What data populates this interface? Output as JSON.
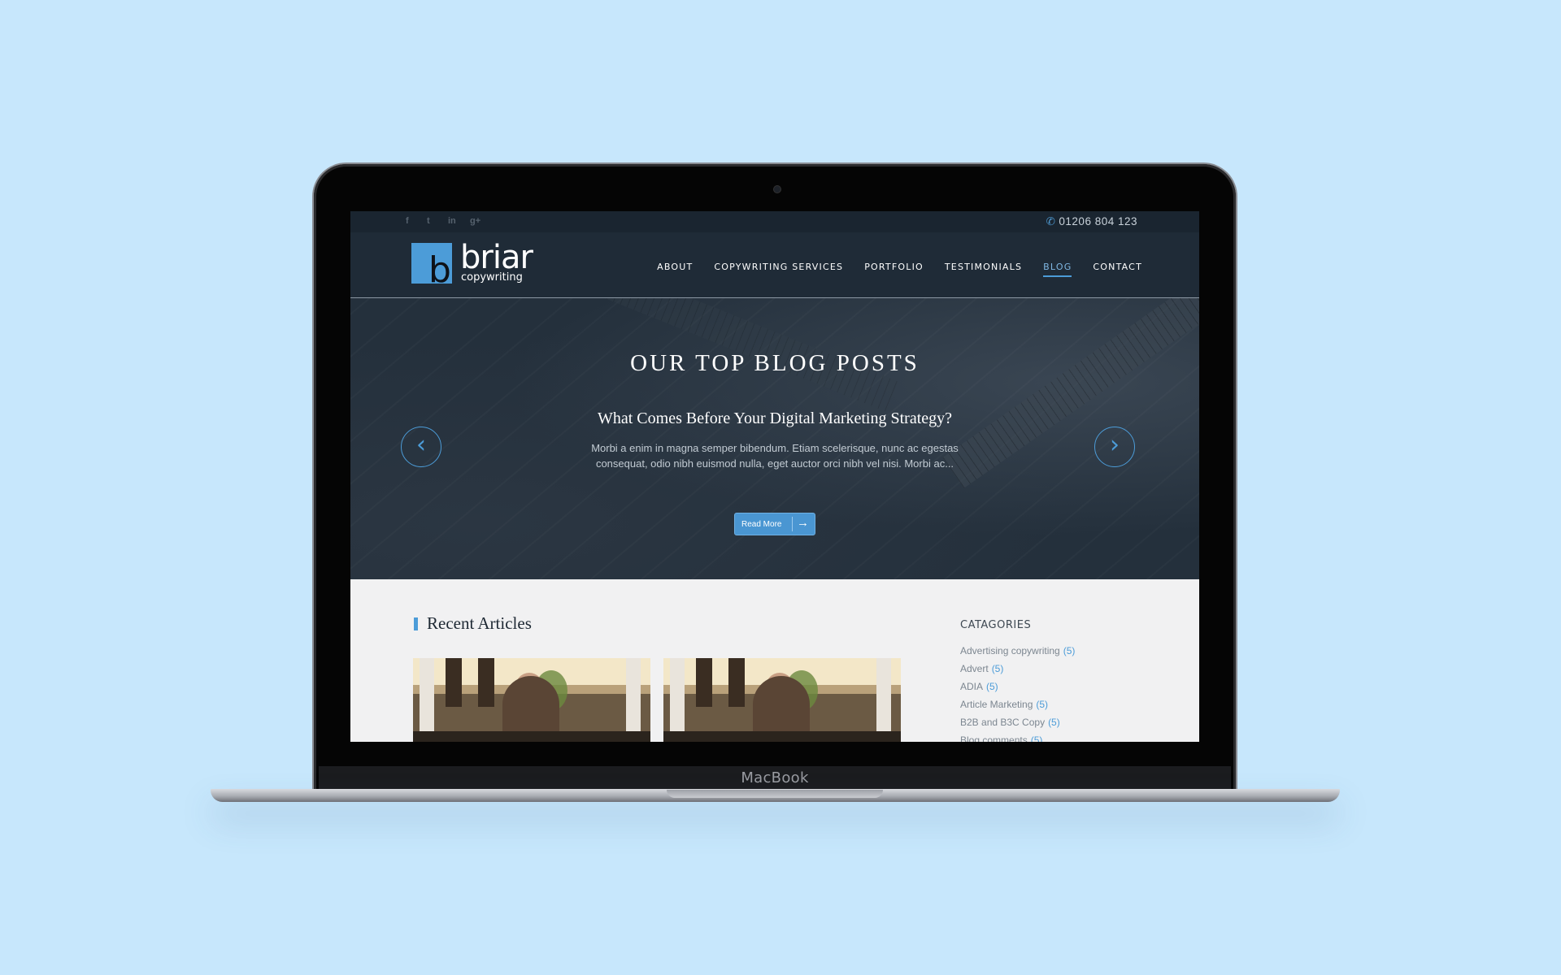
{
  "device": {
    "label": "MacBook"
  },
  "topbar": {
    "social": [
      {
        "name": "facebook-icon",
        "glyph": "f"
      },
      {
        "name": "twitter-icon",
        "glyph": "t"
      },
      {
        "name": "linkedin-icon",
        "glyph": "in"
      },
      {
        "name": "google-plus-icon",
        "glyph": "g+"
      }
    ],
    "phone": "01206 804 123"
  },
  "logo": {
    "letter": "b",
    "name": "briar",
    "tagline": "copywriting"
  },
  "nav": {
    "items": [
      {
        "label": "ABOUT"
      },
      {
        "label": "COPYWRITING SERVICES"
      },
      {
        "label": "PORTFOLIO"
      },
      {
        "label": "TESTIMONIALS"
      },
      {
        "label": "BLOG",
        "active": true
      },
      {
        "label": "CONTACT"
      }
    ]
  },
  "hero": {
    "title": "OUR TOP BLOG POSTS",
    "post_title": "What Comes Before Your Digital Marketing Strategy?",
    "excerpt": "Morbi a enim in magna semper bibendum. Etiam scelerisque, nunc ac egestas consequat, odio nibh euismod nulla, eget auctor orci nibh vel nisi. Morbi ac...",
    "read_more": "Read More",
    "prev_glyph": "‹",
    "next_glyph": "›"
  },
  "content": {
    "section_title": "Recent Articles",
    "categories_title": "CATAGORIES",
    "categories": [
      {
        "label": "Advertising copywriting",
        "count": "(5)"
      },
      {
        "label": "Advert",
        "count": "(5)"
      },
      {
        "label": "ADIA",
        "count": "(5)"
      },
      {
        "label": "Article Marketing",
        "count": "(5)"
      },
      {
        "label": "B2B and B3C Copy",
        "count": "(5)"
      },
      {
        "label": "Blog comments",
        "count": "(5)"
      }
    ]
  },
  "colors": {
    "accent": "#4c9cd8",
    "dark": "#1f2b37",
    "background": "#c7e7fc"
  }
}
